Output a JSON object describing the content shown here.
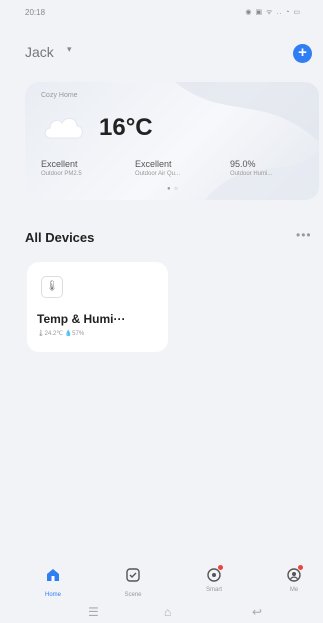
{
  "status_bar": {
    "time": "20:18",
    "icons": "◉ ▣ ᯤ .. ◔ ▭"
  },
  "header": {
    "user_name": "Jack",
    "caret": "▾",
    "add_symbol": "+",
    "add_icon": "plus-circle-icon"
  },
  "weather": {
    "home_name": "Cozy Home",
    "temperature": "16°C",
    "icon": "cloud-icon",
    "stats": [
      {
        "value": "Excellent",
        "label": "Outdoor PM2.5"
      },
      {
        "value": "Excellent",
        "label": "Outdoor Air Qu..."
      },
      {
        "value": "95.0%",
        "label": "Outdoor Humi..."
      }
    ],
    "dots": "● ○"
  },
  "devices": {
    "title": "All Devices",
    "more": "•••",
    "items": [
      {
        "name": "Temp & Humi···",
        "readings": "🌡24.2℃  💧57%",
        "icon": "thermometer-icon",
        "icon_glyph": "🌡"
      }
    ]
  },
  "tabbar": {
    "active_color": "#2f7ef3",
    "tabs": [
      {
        "label": "Home",
        "icon": "home-icon"
      },
      {
        "label": "Scene",
        "icon": "scene-icon"
      },
      {
        "label": "Smart",
        "icon": "smart-icon"
      },
      {
        "label": "Me",
        "icon": "me-icon"
      }
    ]
  },
  "navbar": {
    "menu": "☰",
    "home": "⌂",
    "back": "↩"
  }
}
